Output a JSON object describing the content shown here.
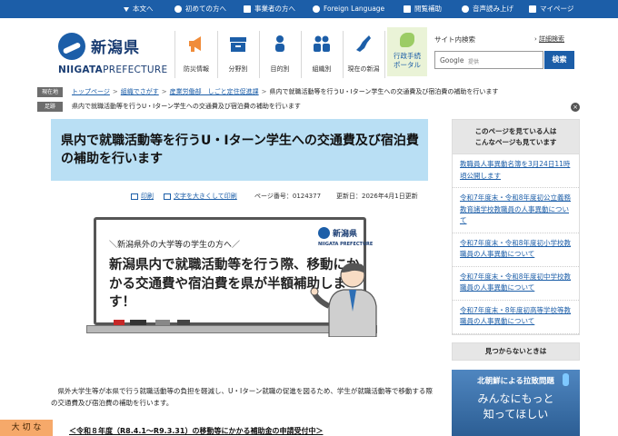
{
  "topbar": {
    "items": [
      {
        "label": "本文へ",
        "icon": "arrow-down-icon"
      },
      {
        "label": "初めての方へ",
        "icon": "info-icon"
      },
      {
        "label": "事業者の方へ",
        "icon": "person-icon"
      },
      {
        "label": "Foreign Language",
        "icon": "globe-icon"
      },
      {
        "label": "閲覧補助",
        "icon": "accessibility-icon"
      },
      {
        "label": "音声読み上げ",
        "icon": "speaker-icon"
      },
      {
        "label": "マイページ",
        "icon": "star-icon"
      }
    ]
  },
  "logo": {
    "name_ja": "新潟県",
    "name_en_bold": "NIIGATA",
    "name_en": "PREFECTURE"
  },
  "nav": [
    {
      "label": "防災情報",
      "icon": "megaphone-icon",
      "color": "#f08c3a"
    },
    {
      "label": "分野別",
      "icon": "folder-icon",
      "color": "#1c5ea8"
    },
    {
      "label": "目的別",
      "icon": "group-icon",
      "color": "#1c5ea8"
    },
    {
      "label": "組織別",
      "icon": "org-icon",
      "color": "#1c5ea8"
    },
    {
      "label": "現在の新潟",
      "icon": "niigata-map-icon",
      "color": "#1c5ea8"
    }
  ],
  "portal": {
    "line1": "行政手続",
    "line2": "ポータル"
  },
  "search": {
    "title": "サイト内検索",
    "advanced": "詳細検索",
    "google": "Google",
    "google_sub": "提供",
    "button": "検索"
  },
  "breadcrumb": {
    "tag": "現在地",
    "links": [
      "トップページ",
      "組織でさがす",
      "産業労働部　しごと定住促進課"
    ],
    "current": "県内で就職活動等を行うU・Iターン学生への交通費及び宿泊費の補助を行います"
  },
  "footprint": {
    "tag": "足跡",
    "text": "県内で就職活動等を行うU・Iターン学生への交通費及び宿泊費の補助を行います",
    "close": "×"
  },
  "page": {
    "title": "県内で就職活動等を行うU・Iターン学生への交通費及び宿泊費の補助を行います",
    "print": "印刷",
    "bigtext": "文字を大きくして印刷",
    "page_no": "ページ番号：0124377",
    "updated": "更新日：2026年4月1日更新"
  },
  "hero": {
    "sub": "＼新潟県外の大学等の学生の方へ／",
    "main": "新潟県内で就職活動等を行う際、移動にかかる交通費や宿泊費を県が半額補助します！",
    "logo_ja": "新潟県",
    "logo_en": "NIIGATA PREFECTURE"
  },
  "body": {
    "intro": "県外大学生等が本県で行う就職活動等の負担を軽減し、U・Iターン就職の促進を図るため、学生が就職活動等で移動する際の交通費及び宿泊費の補助を行います。",
    "section": "＜令和８年度（R8.4.1～R9.3.31）の移動等にかかる補助金の申請受付中＞"
  },
  "side_tab": "大 切 な",
  "right": {
    "head1": "このページを見ている人は",
    "head2": "こんなページも見ています",
    "links": [
      "教職員人事異動名簿を3月24日11時頃公開します",
      "令和7年度末・令和8年度初公立義務教育諸学校教職員の人事異動について",
      "令和7年度末・令和8年度初小学校教職員の人事異動について",
      "令和7年度末・令和8年度初中学校教職員の人事異動について",
      "令和7年度末・8年度初高等学校等教職員の人事異動について"
    ],
    "notfound": "見つからないときは",
    "banner_top": "北朝鮮による拉致問題",
    "banner_main1": "みんなにもっと",
    "banner_main2": "知ってほしい"
  }
}
